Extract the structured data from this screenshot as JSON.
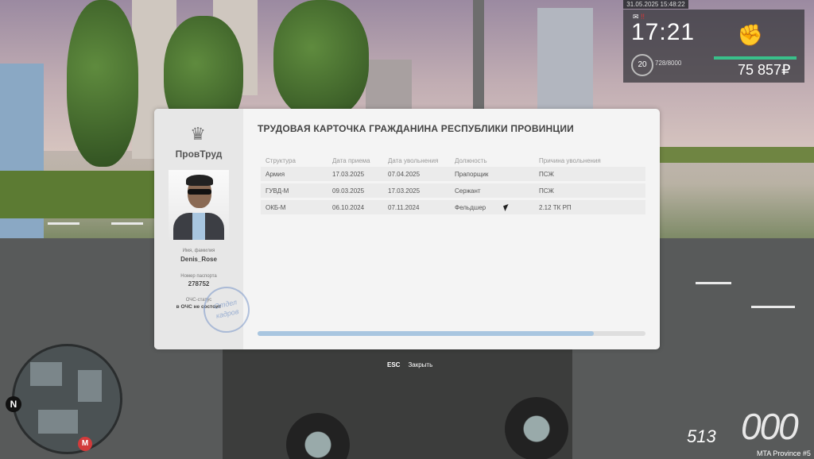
{
  "hud": {
    "date": "31.05.2025 15:48:22",
    "time": "17:21",
    "level": "20",
    "xp": "728/8000",
    "money": "75 857₽",
    "mail_icon": "mail-icon",
    "fist_icon": "fist-icon"
  },
  "minimap": {
    "north": "N",
    "metro": "M"
  },
  "vehicle": {
    "speed": "000",
    "fuel": "513"
  },
  "server": "MTA Province #5",
  "modal": {
    "org": "ПровТруд",
    "title": "ТРУДОВАЯ КАРТОЧКА ГРАЖДАНИНА РЕСПУБЛИКИ ПРОВИНЦИИ",
    "name_label": "Имя, фамилия",
    "name": "Denis_Rose",
    "passport_label": "Номер паспорта",
    "passport": "278752",
    "status_label": "ОЧС-статус",
    "status": "в ОЧС не состоит",
    "stamp": "Отдел кадров",
    "columns": [
      "Структура",
      "Дата приема",
      "Дата увольнения",
      "Должность",
      "Причина увольнения"
    ],
    "rows": [
      [
        "Армия",
        "17.03.2025",
        "07.04.2025",
        "Прапорщик",
        "ПСЖ"
      ],
      [
        "ГУВД-М",
        "09.03.2025",
        "17.03.2025",
        "Сержант",
        "ПСЖ"
      ],
      [
        "ОКБ-М",
        "06.10.2024",
        "07.11.2024",
        "Фельдшер",
        "2.12 ТК РП"
      ]
    ]
  },
  "hint": {
    "key": "ESC",
    "action": "Закрыть"
  }
}
